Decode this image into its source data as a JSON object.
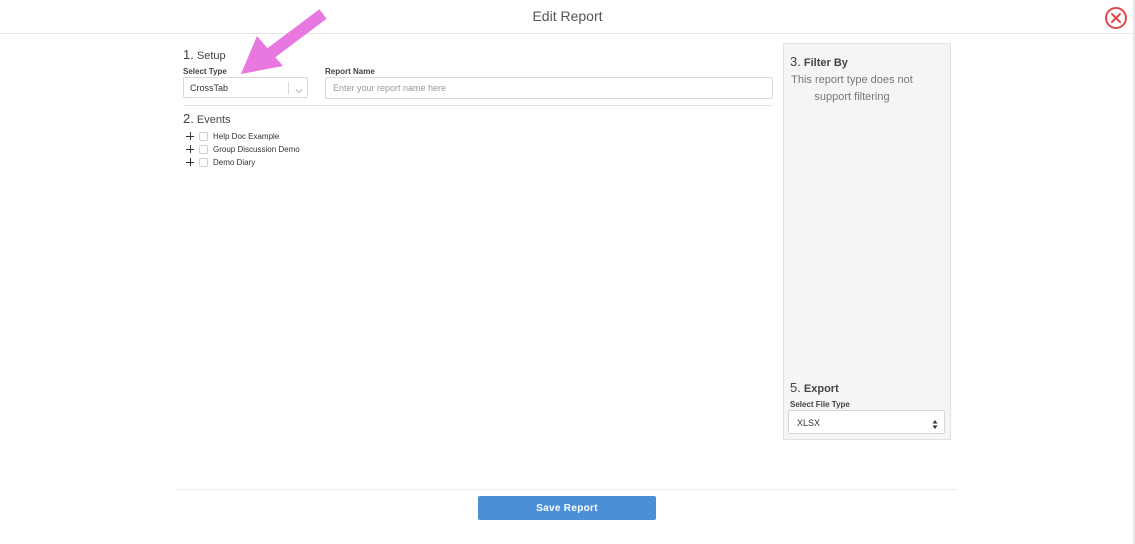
{
  "modal": {
    "title": "Edit Report"
  },
  "setup": {
    "number": "1.",
    "heading": "Setup",
    "select_type_label": "Select Type",
    "select_type_value": "CrossTab",
    "report_name_label": "Report Name",
    "report_name_value": "",
    "report_name_placeholder": "Enter your report name here"
  },
  "events": {
    "number": "2.",
    "heading": "Events",
    "items": [
      {
        "label": "Help Doc Example",
        "checked": false
      },
      {
        "label": "Group Discussion Demo",
        "checked": false
      },
      {
        "label": "Demo Diary",
        "checked": false
      }
    ]
  },
  "filter": {
    "number": "3.",
    "heading": "Filter By",
    "note": "This report type does not support filtering"
  },
  "export": {
    "number": "5.",
    "heading": "Export",
    "file_type_label": "Select File Type",
    "file_type_value": "XLSX"
  },
  "footer": {
    "save_label": "Save Report"
  },
  "icons": {
    "close": "close-circle-icon",
    "select_chevron": "chevron-down-icon",
    "export_chevron": "up-down-chevron-icon",
    "expand": "plus-icon",
    "annotation_arrow": "arrow-annotation"
  },
  "colors": {
    "accent": "#4a90d9",
    "close": "#e0474c",
    "annotation_arrow": "#e877e0",
    "panel_bg": "#f5f5f5"
  }
}
